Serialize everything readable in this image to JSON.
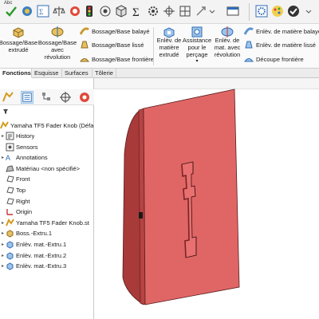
{
  "top_strip": {
    "abc_label": "Abc",
    "icons": [
      "spell-check-icon",
      "hole-wizard-icon",
      "equation-icon",
      "balance-icon",
      "color-icon",
      "traffic-light-icon",
      "target-icon",
      "cube-icon",
      "sigma-icon",
      "gear-wheel-icon",
      "crosshair-icon",
      "grid-icon",
      "move-icon",
      "dropdown-icon",
      "ribbon-icon",
      "gear-icon",
      "check-icon",
      "dropdown-icon-2"
    ]
  },
  "ribbon": {
    "extrude_boss": "Bossage/Base extrudé",
    "revolve_boss": "Bossage/Base avec révolution",
    "swept_boss": "Bossage/Base balayé",
    "lofted_boss": "Bossage/Base lissé",
    "boundary_boss": "Bossage/Base frontière",
    "extrude_cut": "Enlèv. de matière extrudé",
    "hole_wizard": "Assistance pour le perçage",
    "revolve_cut": "Enlèv. de mat. avec révolution",
    "swept_cut": "Enlèv. de matière balayé",
    "lofted_cut": "Enlèv. de matière lissé",
    "boundary_cut": "Découpe frontière"
  },
  "tabs": [
    "Fonctions",
    "Esquisse",
    "Surfaces",
    "Tôlerie"
  ],
  "active_tab": "Fonctions",
  "tree": {
    "root": "Yamaha TF5 Fader Knob  (Défa",
    "items": [
      {
        "label": "History",
        "icon": "history-icon",
        "arrow": "▸"
      },
      {
        "label": "Sensors",
        "icon": "sensor-icon",
        "arrow": ""
      },
      {
        "label": "Annotations",
        "icon": "annotations-icon",
        "arrow": "▸"
      },
      {
        "label": "Matériau <non spécifié>",
        "icon": "material-icon",
        "arrow": ""
      },
      {
        "label": "Front",
        "icon": "plane-icon",
        "arrow": ""
      },
      {
        "label": "Top",
        "icon": "plane-icon",
        "arrow": ""
      },
      {
        "label": "Right",
        "icon": "plane-icon",
        "arrow": ""
      },
      {
        "label": "Origin",
        "icon": "origin-icon",
        "arrow": ""
      },
      {
        "label": "Yamaha TF5 Fader Knob.st",
        "icon": "part-icon",
        "arrow": "▸"
      },
      {
        "label": "Boss.-Extru.1",
        "icon": "extrude-icon",
        "arrow": "▸"
      },
      {
        "label": "Enlèv. mat.-Extru.1",
        "icon": "cut-icon",
        "arrow": "▸"
      },
      {
        "label": "Enlèv. mat.-Extru.2",
        "icon": "cut-icon",
        "arrow": "▸"
      },
      {
        "label": "Enlèv. mat.-Extru.3",
        "icon": "cut-icon",
        "arrow": "▸"
      }
    ]
  },
  "colors": {
    "model_face": "#e06666",
    "model_side": "#a83a3a",
    "model_edge": "#5a1a1a",
    "accent_blue": "#1e6fc2"
  }
}
